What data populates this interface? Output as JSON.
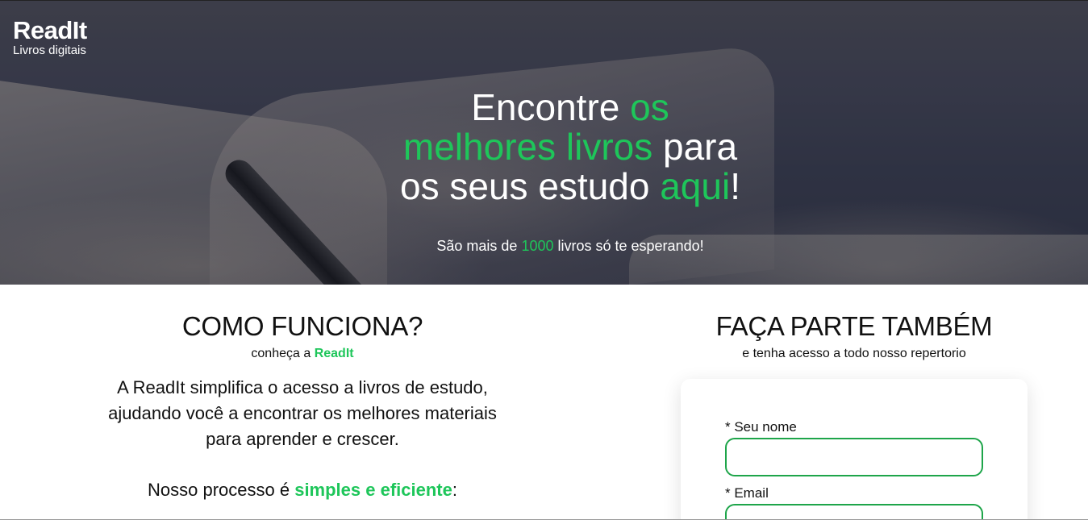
{
  "brand": {
    "name": "ReadIt",
    "tagline": "Livros digitais"
  },
  "hero": {
    "headline_parts": [
      "Encontre ",
      "os",
      " ",
      "melhores livros",
      " para",
      " ",
      "os seus estudo ",
      "aqui",
      "!"
    ],
    "subtitle_parts": [
      "São mais de ",
      "1000",
      " livros só te esperando!"
    ]
  },
  "how": {
    "title": "COMO FUNCIONA?",
    "subtitle_prefix": "conheça a ",
    "subtitle_brand": "ReadIt",
    "description": "A ReadIt simplifica o acesso a livros de estudo, ajudando você a encontrar os melhores materiais para aprender e crescer.",
    "process_prefix": "Nosso processo é ",
    "process_highlight": "simples e eficiente",
    "process_suffix": ":"
  },
  "join": {
    "title": "FAÇA PARTE TAMBÉM",
    "subtitle": "e tenha acesso a todo nosso repertorio",
    "fields": [
      {
        "label": "* Seu nome",
        "value": ""
      },
      {
        "label": "* Email",
        "value": ""
      }
    ]
  },
  "colors": {
    "accent": "#1ec65a",
    "input_border": "#1ea54a"
  }
}
